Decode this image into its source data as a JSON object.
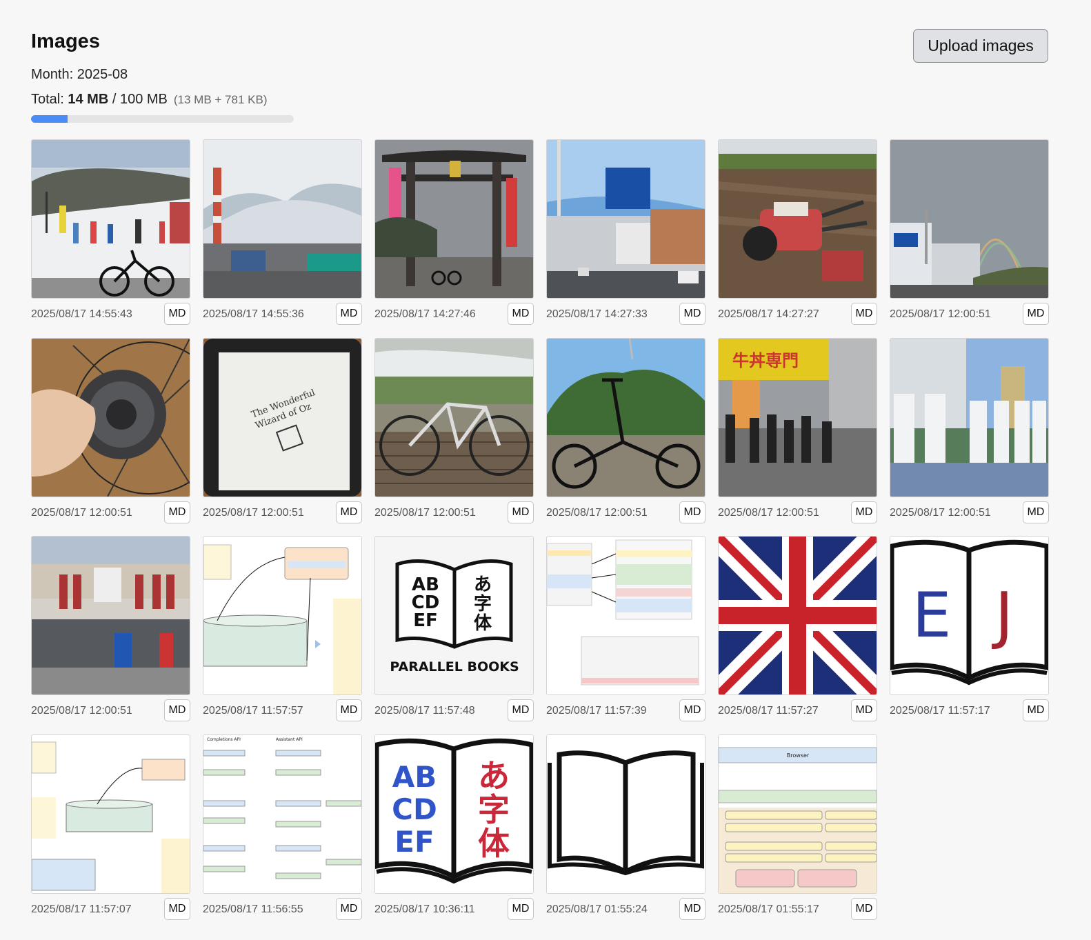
{
  "header": {
    "title": "Images",
    "month_label": "Month: 2025-08",
    "total_prefix": "Total:",
    "total_used": "14 MB",
    "total_sep": "/ 100 MB",
    "total_detail": "(13 MB + 781 KB)",
    "usage_fraction": 0.14,
    "upload_label": "Upload images"
  },
  "colors": {
    "progress_fill": "#4a8cf7",
    "progress_track": "#e4e4e6"
  },
  "md_label": "MD",
  "images": [
    {
      "timestamp": "2025/08/17 14:55:43",
      "content": "ski-slope-folding-bike-photo"
    },
    {
      "timestamp": "2025/08/17 14:55:36",
      "content": "industrial-chimney-trucks-photo"
    },
    {
      "timestamp": "2025/08/17 14:27:46",
      "content": "torii-gate-bike-photo"
    },
    {
      "timestamp": "2025/08/17 14:27:33",
      "content": "road-sign-street-photo"
    },
    {
      "timestamp": "2025/08/17 14:27:27",
      "content": "tiller-in-field-photo"
    },
    {
      "timestamp": "2025/08/17 12:00:51",
      "content": "rainbow-over-store-photo"
    },
    {
      "timestamp": "2025/08/17 12:00:51",
      "content": "bike-cassette-in-hand-photo"
    },
    {
      "timestamp": "2025/08/17 12:00:51",
      "content": "ereader-wizard-of-oz-photo"
    },
    {
      "timestamp": "2025/08/17 12:00:51",
      "content": "road-bike-on-deck-photo"
    },
    {
      "timestamp": "2025/08/17 12:00:51",
      "content": "folding-bike-on-beach-photo"
    },
    {
      "timestamp": "2025/08/17 12:00:51",
      "content": "restaurant-queue-photo"
    },
    {
      "timestamp": "2025/08/17 12:00:51",
      "content": "be-kobe-monument-photo"
    },
    {
      "timestamp": "2025/08/17 12:00:51",
      "content": "udon-shop-storefront-photo"
    },
    {
      "timestamp": "2025/08/17 11:57:57",
      "content": "api-diagram-screenshot"
    },
    {
      "timestamp": "2025/08/17 11:57:48",
      "content": "parallel-books-logo"
    },
    {
      "timestamp": "2025/08/17 11:57:39",
      "content": "code-diagram-screenshot"
    },
    {
      "timestamp": "2025/08/17 11:57:27",
      "content": "union-jack-flag"
    },
    {
      "timestamp": "2025/08/17 11:57:17",
      "content": "open-book-e-j-icon"
    },
    {
      "timestamp": "2025/08/17 11:57:07",
      "content": "api-flow-diagram-screenshot"
    },
    {
      "timestamp": "2025/08/17 11:56:55",
      "content": "chat-api-comparison-screenshot"
    },
    {
      "timestamp": "2025/08/17 10:36:11",
      "content": "open-book-abcdef-icon"
    },
    {
      "timestamp": "2025/08/17 01:55:24",
      "content": "open-book-outline-icon"
    },
    {
      "timestamp": "2025/08/17 01:55:17",
      "content": "architecture-diagram-screenshot"
    }
  ]
}
